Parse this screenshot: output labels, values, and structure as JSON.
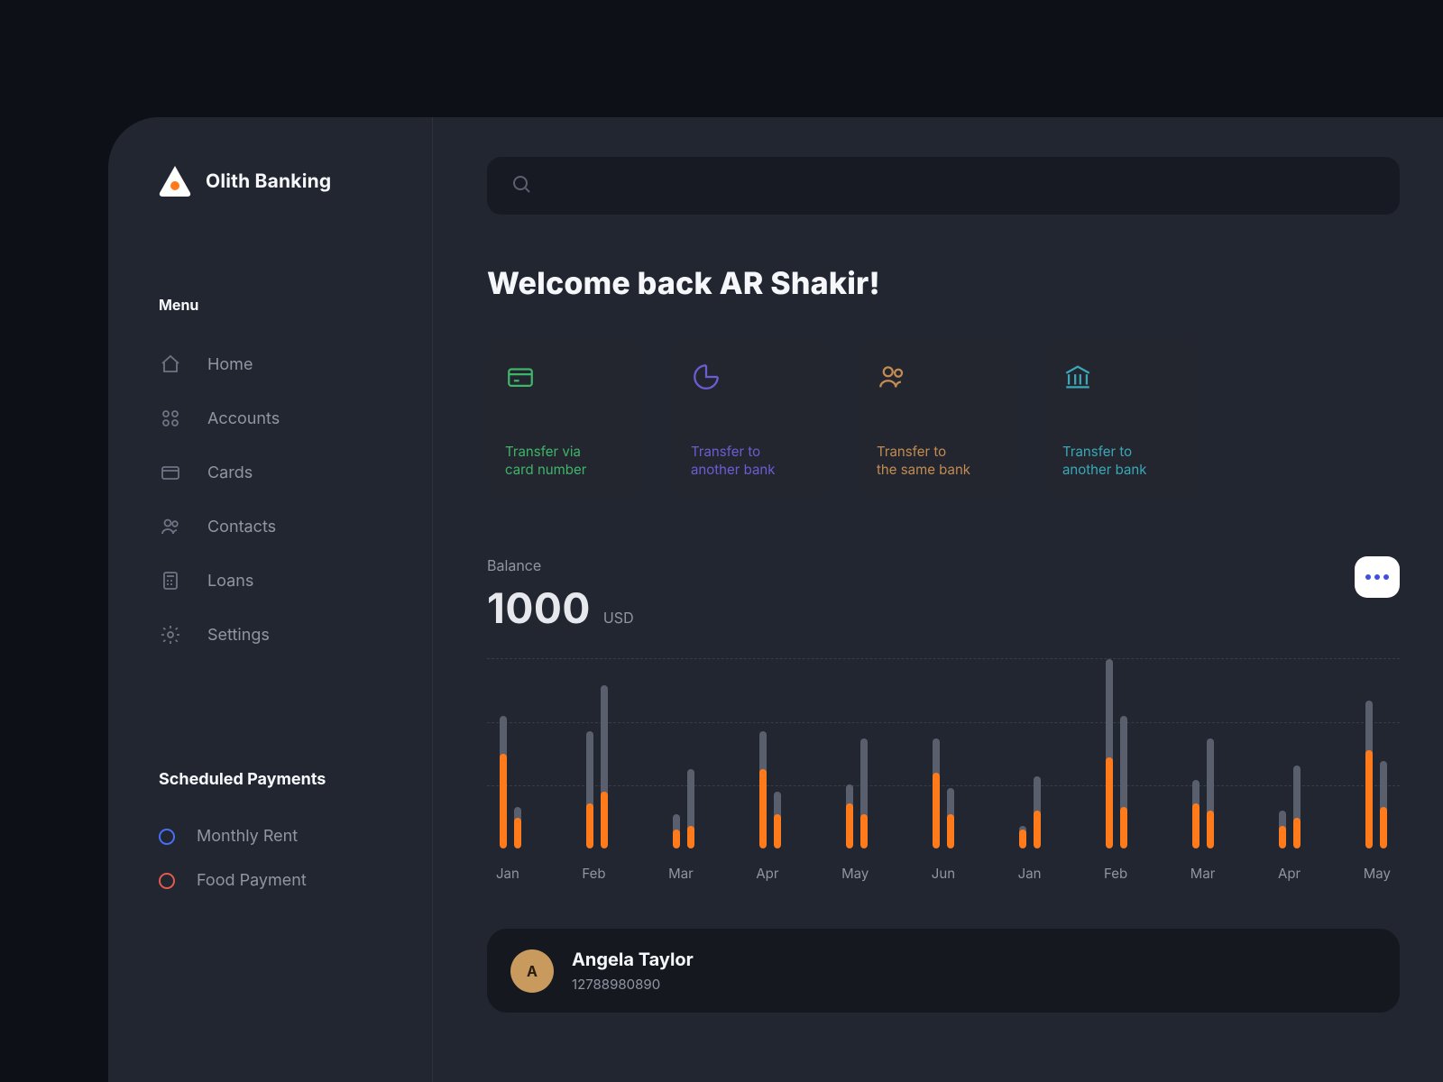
{
  "brand": {
    "name": "Olith Banking"
  },
  "sidebar": {
    "menu_heading": "Menu",
    "items": [
      {
        "label": "Home"
      },
      {
        "label": "Accounts"
      },
      {
        "label": "Cards"
      },
      {
        "label": "Contacts"
      },
      {
        "label": "Loans"
      },
      {
        "label": "Settings"
      }
    ],
    "scheduled_heading": "Scheduled Payments",
    "scheduled": [
      {
        "label": "Monthly Rent",
        "color": "blue"
      },
      {
        "label": "Food Payment",
        "color": "red"
      }
    ]
  },
  "header": {
    "welcome": "Welcome back AR Shakir!"
  },
  "tiles": [
    {
      "line1": "Transfer via",
      "line2": "card number"
    },
    {
      "line1": "Transfer to",
      "line2": "another bank"
    },
    {
      "line1": "Transfer to",
      "line2": "the same bank"
    },
    {
      "line1": "Transfer to",
      "line2": "another bank"
    }
  ],
  "balance": {
    "label": "Balance",
    "value": "1000",
    "currency": "USD"
  },
  "chart_data": {
    "type": "bar",
    "title": "Balance",
    "ylabel": "",
    "xlabel": "",
    "ylim": [
      0,
      100
    ],
    "grid": [
      33,
      66,
      100
    ],
    "categories": [
      "Jan",
      "Feb",
      "Mar",
      "Apr",
      "May",
      "Jun",
      "Jan",
      "Feb",
      "Mar",
      "Apr",
      "May"
    ],
    "series": [
      {
        "name": "total-a",
        "values": [
          70,
          62,
          18,
          62,
          34,
          58,
          12,
          100,
          36,
          20,
          78
        ]
      },
      {
        "name": "fill-a",
        "values": [
          50,
          24,
          10,
          42,
          24,
          40,
          10,
          48,
          24,
          12,
          52
        ]
      },
      {
        "name": "total-b",
        "values": [
          22,
          86,
          42,
          30,
          58,
          32,
          38,
          70,
          58,
          44,
          46
        ]
      },
      {
        "name": "fill-b",
        "values": [
          16,
          30,
          12,
          18,
          18,
          18,
          20,
          22,
          20,
          16,
          22
        ]
      }
    ]
  },
  "contact": {
    "name": "Angela Taylor",
    "number": "12788980890",
    "initials": "A"
  }
}
